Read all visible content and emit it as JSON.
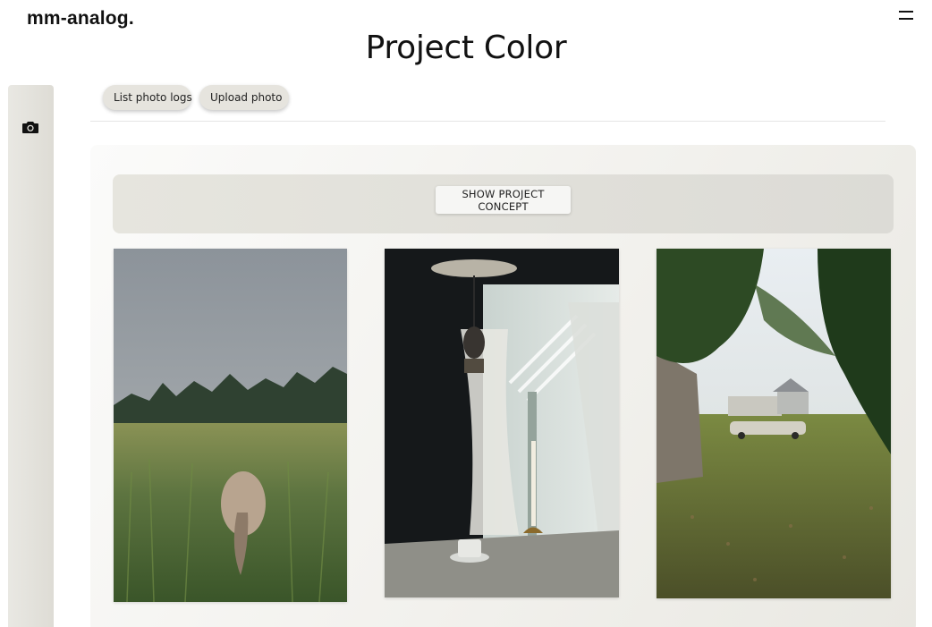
{
  "header": {
    "logo": "mm-analog.",
    "menu_icon": "hamburger-menu-icon"
  },
  "page": {
    "title": "Project Color"
  },
  "sidebar": {
    "items": [
      {
        "icon": "camera-icon"
      }
    ]
  },
  "toolbar": {
    "list_label": "List photo logs",
    "upload_label": "Upload photo"
  },
  "concept": {
    "button_label": "SHOW PROJECT CONCEPT"
  },
  "gallery": {
    "photos": [
      {
        "subject": "horse in tall grass field"
      },
      {
        "subject": "window with hanging lamp and candle on table"
      },
      {
        "subject": "backyard with shed and parked car"
      }
    ]
  },
  "colors": {
    "background": "#ffffff",
    "rail": "#e3e2dc",
    "pill": "#e6e4de",
    "panel": "#f2f1ed",
    "concept_bar": "#e1e0da"
  }
}
